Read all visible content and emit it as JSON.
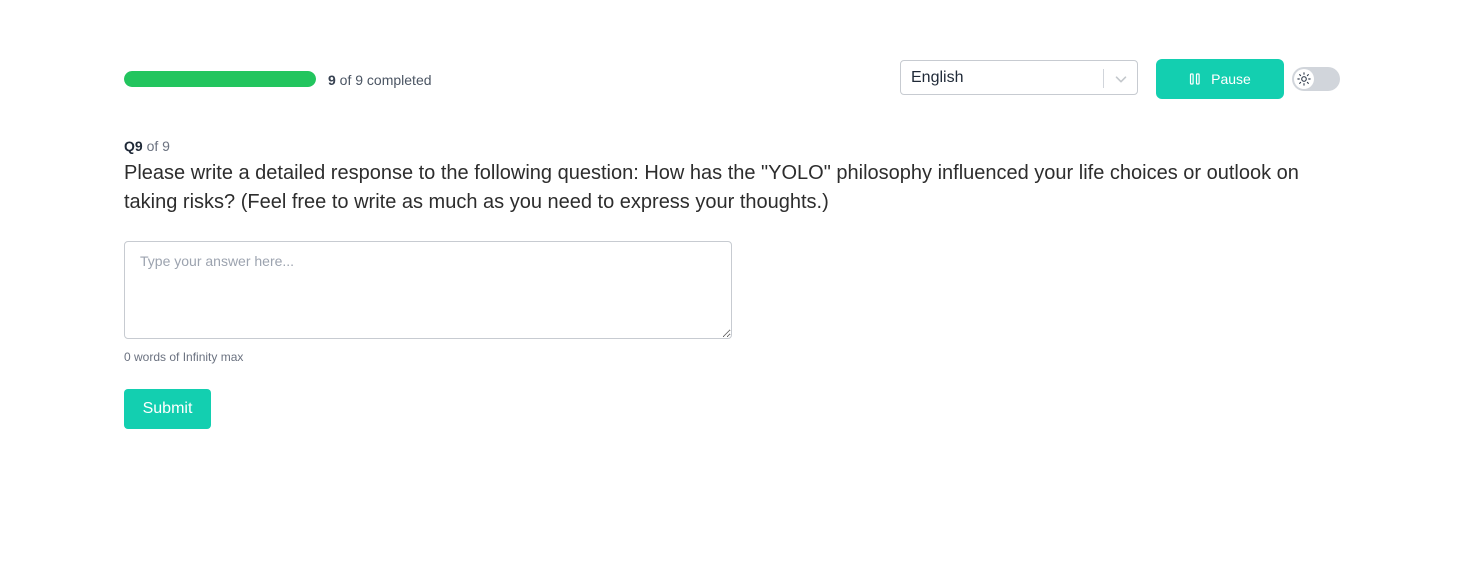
{
  "progress": {
    "current": "9",
    "rest_text": " of 9 completed",
    "fraction": 1.0,
    "fill_color": "#22c55e"
  },
  "language": {
    "selected": "English",
    "chevron_icon": "chevron-down-icon"
  },
  "pause": {
    "label": "Pause",
    "icon": "pause-icon",
    "color": "#13cfb0"
  },
  "theme_toggle": {
    "icon": "sun-icon",
    "state": "off"
  },
  "question": {
    "number": "Q9",
    "of_total": " of 9",
    "text": "Please write a detailed response to the following question: How has the \"YOLO\" philosophy influenced your life choices or outlook on taking risks? (Feel free to write as much as you need to express your thoughts.)"
  },
  "answer": {
    "value": "",
    "placeholder": "Type your answer here..."
  },
  "word_count": "0 words of Infinity max",
  "submit": {
    "label": "Submit",
    "color": "#13cfb0"
  }
}
